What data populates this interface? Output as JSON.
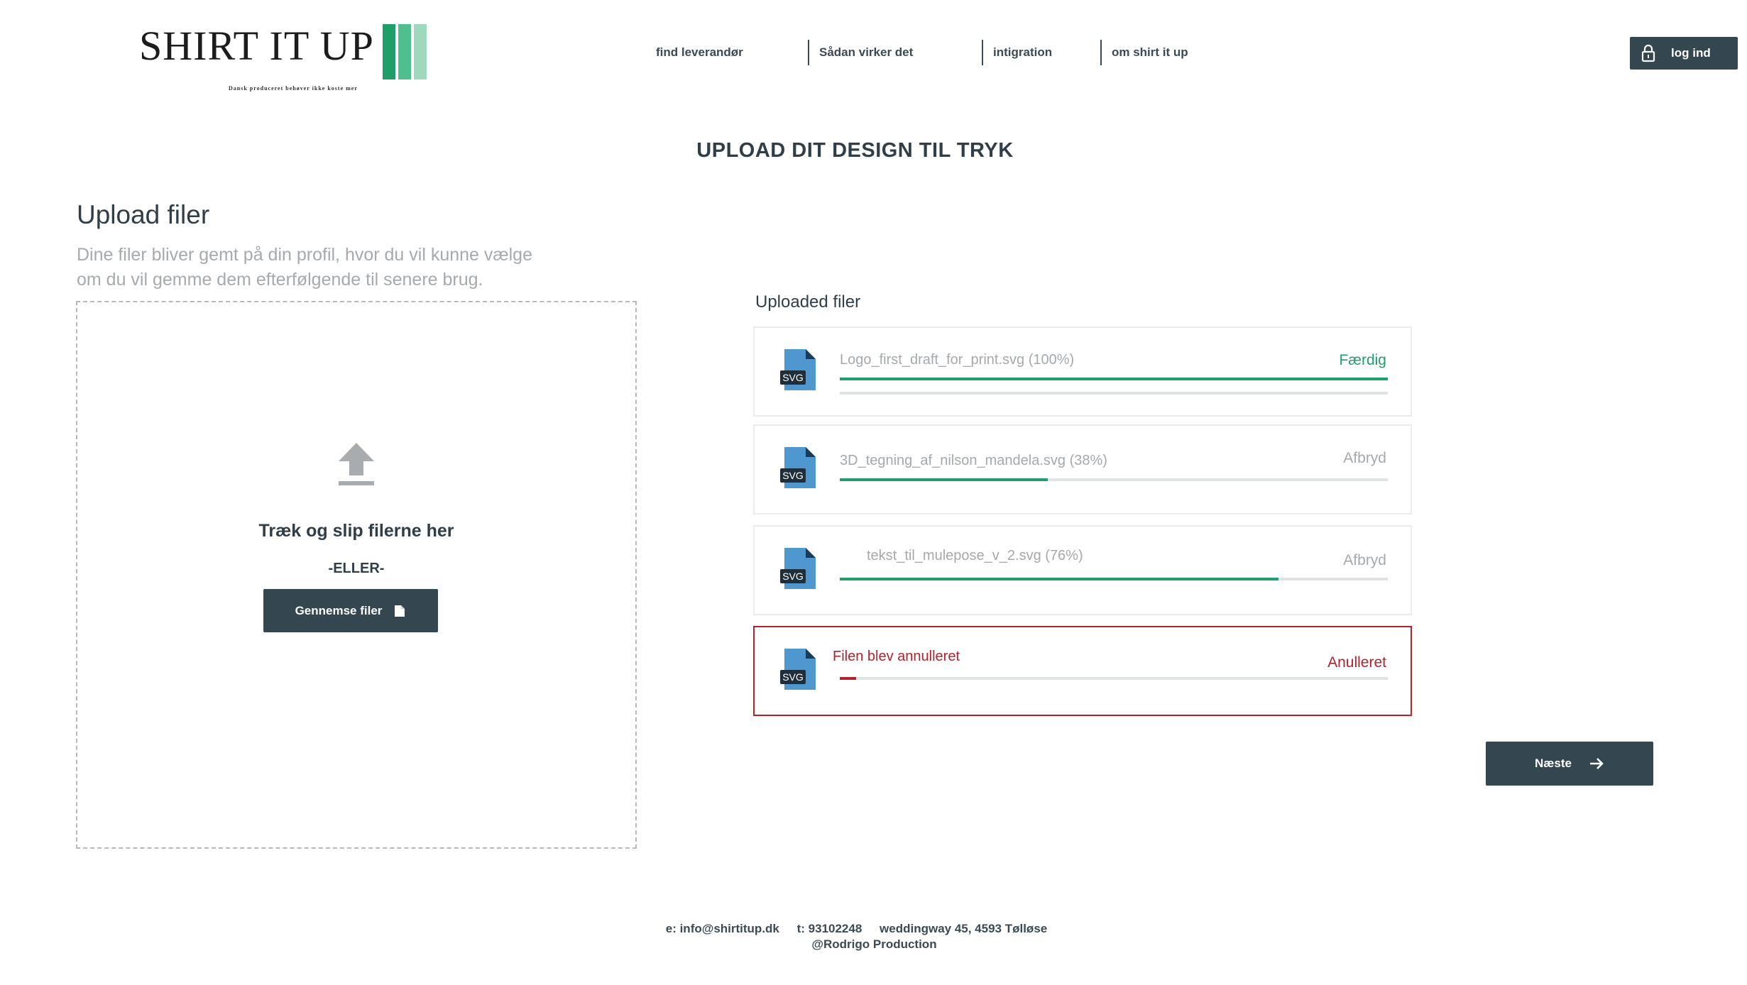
{
  "header": {
    "logo": {
      "text": "SHIRT IT UP",
      "tagline": "Dansk produceret behøver ikke koste mer",
      "bar_colors": [
        "#1f9e6a",
        "#4fbf8d",
        "#9fd9bd"
      ]
    },
    "nav": [
      {
        "label": "find leverandør"
      },
      {
        "label": "Sådan virker det"
      },
      {
        "label": "intigration"
      },
      {
        "label": "om shirt it up"
      }
    ],
    "login_label": "log ind"
  },
  "page_title": "UPLOAD DIT DESIGN TIL TRYK",
  "upload": {
    "title": "Upload filer",
    "description_line1": "Dine filer bliver gemt på din profil, hvor du vil kunne vælge",
    "description_line2": "om du vil gemme dem efterfølgende til senere brug.",
    "drop_text": "Træk og slip filerne her",
    "or_text": "-ELLER-",
    "browse_label": "Gennemse filer"
  },
  "files": {
    "title": "Uploaded filer",
    "icon_label": "SVG",
    "items": [
      {
        "name": "Logo_first_draft_for_print.svg (100%)",
        "status": "Færdig",
        "progress": 1.0,
        "state": "done"
      },
      {
        "name": "3D_tegning_af_nilson_mandela.svg (38%)",
        "status": "Afbryd",
        "progress": 0.38,
        "state": "uploading"
      },
      {
        "name": "tekst_til_mulepose_v_2.svg (76%)",
        "status": "Afbryd",
        "progress": 0.8,
        "state": "uploading"
      },
      {
        "name": "Filen blev annulleret",
        "status": "Anulleret",
        "progress": 0.03,
        "state": "cancelled"
      }
    ]
  },
  "next_label": "Næste",
  "footer": {
    "email": "e: info@shirtitup.dk",
    "phone": "t: 93102248",
    "address": "weddingway 45, 4593 Tølløse",
    "credit": "@Rodrigo Production"
  },
  "colors": {
    "primary": "#344650",
    "success": "#1f9e6a",
    "danger": "#b3232c",
    "muted": "#a5a9ac"
  }
}
